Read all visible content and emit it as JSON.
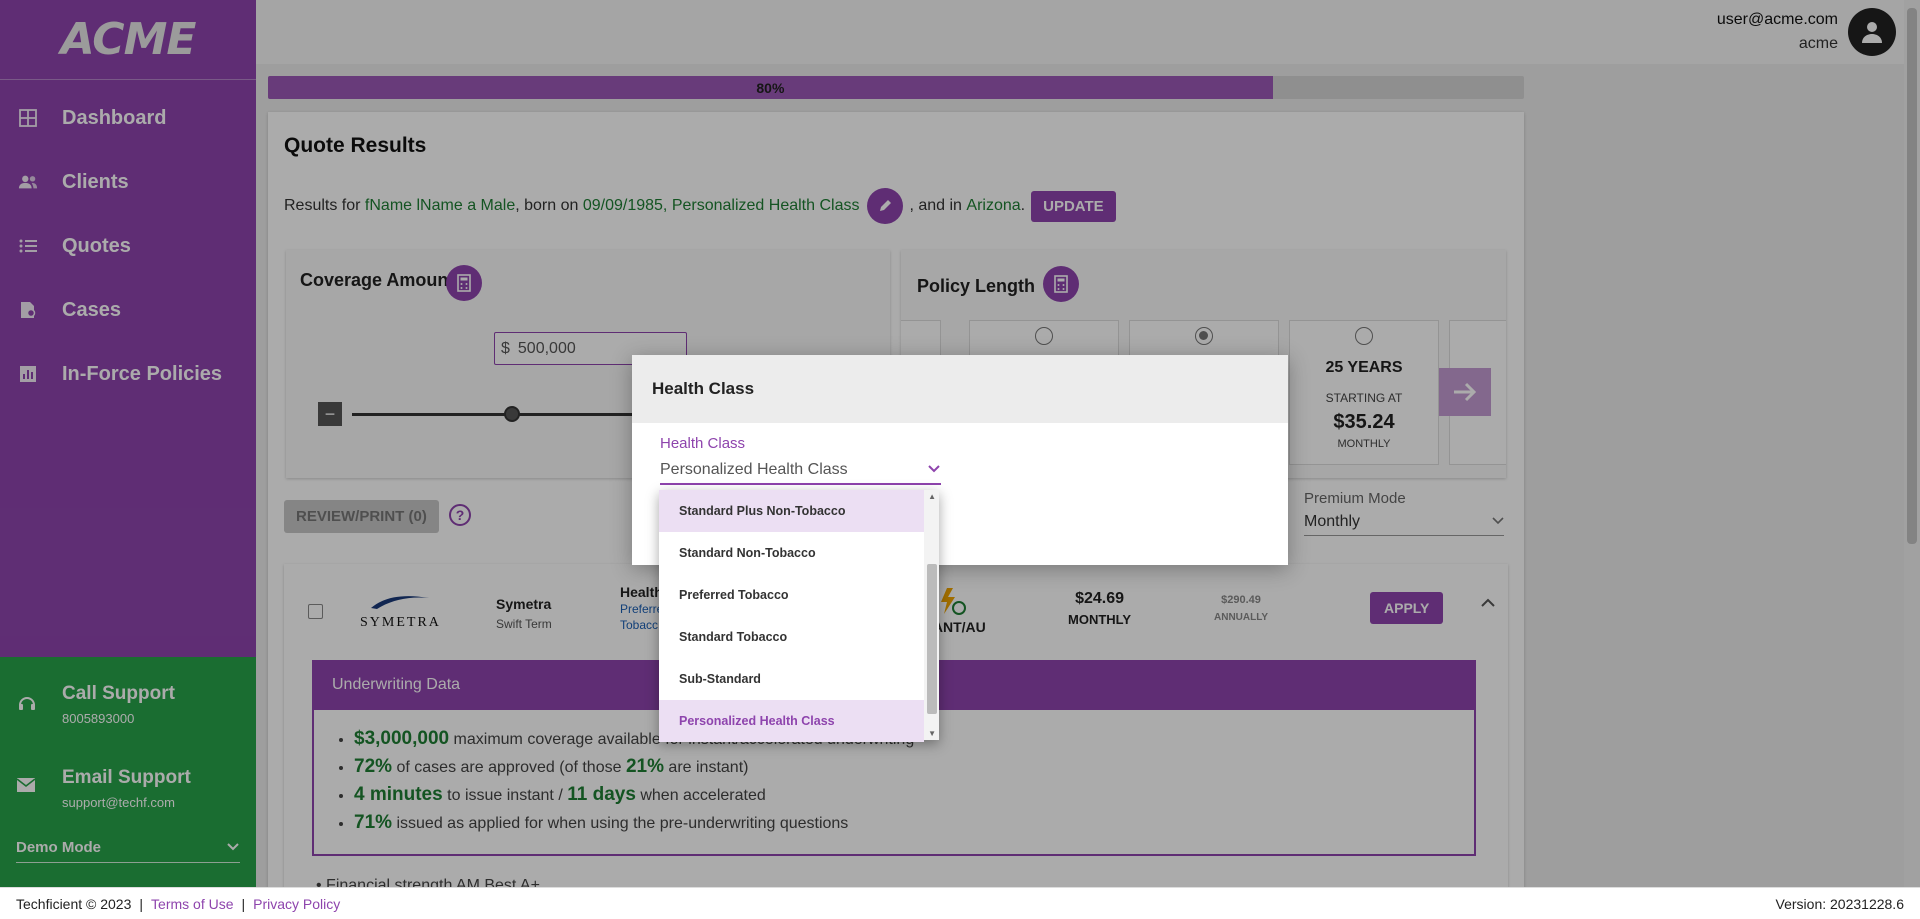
{
  "app": {
    "logo_text": "ACME"
  },
  "sidebar": {
    "items": [
      {
        "label": "Dashboard",
        "icon": "dashboard-icon"
      },
      {
        "label": "Clients",
        "icon": "people-icon"
      },
      {
        "label": "Quotes",
        "icon": "list-icon"
      },
      {
        "label": "Cases",
        "icon": "folder-icon"
      },
      {
        "label": "In-Force Policies",
        "icon": "chart-icon"
      }
    ],
    "support": {
      "call_title": "Call Support",
      "call_value": "8005893000",
      "email_title": "Email Support",
      "email_value": "support@techf.com",
      "mode_label": "Demo Mode"
    }
  },
  "header": {
    "user_email": "user@acme.com",
    "user_org": "acme"
  },
  "progress": {
    "label": "80%",
    "value": 0.8
  },
  "quote": {
    "title": "Quote Results",
    "results_prefix": "Results for",
    "client_name": "fName lName",
    "a": "a",
    "gender": "Male",
    "born_text": ", born on",
    "dob": "09/09/1985",
    "health_class": "Personalized Health Class",
    "state_prefix": ", and in",
    "state": "Arizona",
    "period": ".",
    "update_label": "UPDATE"
  },
  "coverage": {
    "title": "Coverage Amount",
    "currency": "$",
    "amount": "500,000",
    "minus": "−"
  },
  "policy": {
    "title": "Policy Length",
    "terms": [
      {
        "years": "",
        "selected": false
      },
      {
        "years": "",
        "selected": true
      },
      {
        "years": "25 YEARS",
        "start": "STARTING AT",
        "price": "$35.24",
        "mode": "MONTHLY",
        "selected": false
      }
    ]
  },
  "actions": {
    "review_label": "REVIEW/PRINT (0)",
    "help": "?"
  },
  "premium_mode": {
    "label": "Premium Mode",
    "value": "Monthly"
  },
  "result": {
    "carrier": "SYMETRA",
    "product_name": "Symetra",
    "product_sub": "Swift Term",
    "hc_title": "Health",
    "hc_line1": "Preferre",
    "hc_line2": "Tobacc",
    "instant": "STANT/AU",
    "monthly_price": "$24.69",
    "monthly_label": "MONTHLY",
    "annual_price": "$290.49",
    "annual_label": "ANNUALLY",
    "apply_label": "APPLY"
  },
  "underwriting": {
    "title": "Underwriting Data",
    "max_coverage": "$3,000,000",
    "max_text": " maximum coverage available for instant/accelerated underwriting",
    "approved": "72%",
    "approved_text": " of cases are approved (of those ",
    "instant_pct": "21%",
    "instant_text": " are instant)",
    "issue_instant": "4 minutes",
    "issue_text": " to issue instant / ",
    "issue_accel": "11 days",
    "accel_text": " when accelerated",
    "issued_pct": "71%",
    "issued_text": " issued as applied for when using the pre-underwriting questions"
  },
  "financial": "Financial strength AM Best A+",
  "modal": {
    "title": "Health Class",
    "field_label": "Health Class",
    "field_value": "Personalized Health Class",
    "options": [
      "Standard Plus Non-Tobacco",
      "Standard Non-Tobacco",
      "Preferred Tobacco",
      "Standard Tobacco",
      "Sub-Standard",
      "Personalized Health Class"
    ]
  },
  "footer": {
    "copyright": "Techficient © 2023",
    "sep": "|",
    "terms": "Terms of Use",
    "privacy": "Privacy Policy",
    "version": "Version: 20231228.6"
  },
  "colors": {
    "purple": "#8e44ad",
    "green": "#27a349",
    "money_green": "#1e7e34"
  }
}
